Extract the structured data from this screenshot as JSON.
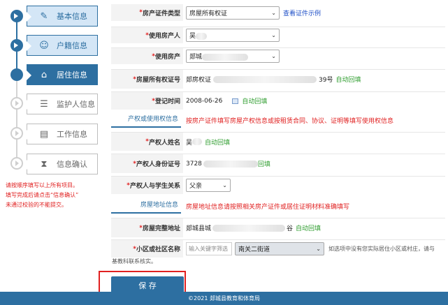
{
  "sidebar": {
    "steps": [
      {
        "label": "基本信息",
        "icon": "edit-document-icon",
        "state": "done"
      },
      {
        "label": "户籍信息",
        "icon": "person-icon",
        "state": "done"
      },
      {
        "label": "居住信息",
        "icon": "house-icon",
        "state": "current"
      },
      {
        "label": "监护人信息",
        "icon": "guardian-list-icon",
        "state": "todo"
      },
      {
        "label": "工作信息",
        "icon": "clipboard-icon",
        "state": "todo"
      },
      {
        "label": "信息确认",
        "icon": "hourglass-icon",
        "state": "todo"
      }
    ],
    "note_lines": [
      "请按顺序填写以上所有项目。",
      "填写完成后请点击“信息确认”",
      "未通过校验的不能提交。"
    ]
  },
  "form": {
    "cert_type": {
      "label": "房产证件类型",
      "value": "房屋所有权证",
      "link": "查看证件示例"
    },
    "user": {
      "label": "使用房产人",
      "value": "吴"
    },
    "property": {
      "label": "使用房产",
      "value": "郯城"
    },
    "cert_no": {
      "label": "房屋所有权证号",
      "prefix": "郯房权证",
      "suffix": "39号",
      "status": "自动回填"
    },
    "reg_time": {
      "label": "登记时间",
      "value": "2008-06-26",
      "status": "自动回填"
    },
    "owner_section": {
      "title": "产权或使用权信息",
      "desc": "按房产证件填写房屋产权信息或按租赁合同、协议、证明等填写使用权信息"
    },
    "owner_name": {
      "label": "产权人姓名",
      "value": "吴",
      "status": "自动回填"
    },
    "owner_id": {
      "label": "产权人身份证号",
      "value": "3728",
      "status": "回填"
    },
    "relation": {
      "label": "产权人与学生关系",
      "value": "父亲"
    },
    "address_section": {
      "title": "房屋地址信息",
      "desc": "房屋地址信息请按照相关房产证件或居住证明材料准确填写"
    },
    "full_address": {
      "label": "房屋完整地址",
      "prefix": "郯城县城",
      "suffix": "谷",
      "status": "自动回填"
    },
    "community": {
      "label": "小区或社区名称",
      "placeholder": "输入关键字筛选",
      "value": "南关二街道",
      "hint": "如选项中没有您实际居住小区或村庄，请与"
    },
    "tail_note": "基教科联系核实。"
  },
  "save_label": "保 存",
  "footer_text": "©2021  郯城县教育和体育局",
  "colors": {
    "primary": "#2d6fa1",
    "required": "#e02020",
    "auto_fill": "#2f9d2f",
    "link": "#1e4fc7"
  }
}
